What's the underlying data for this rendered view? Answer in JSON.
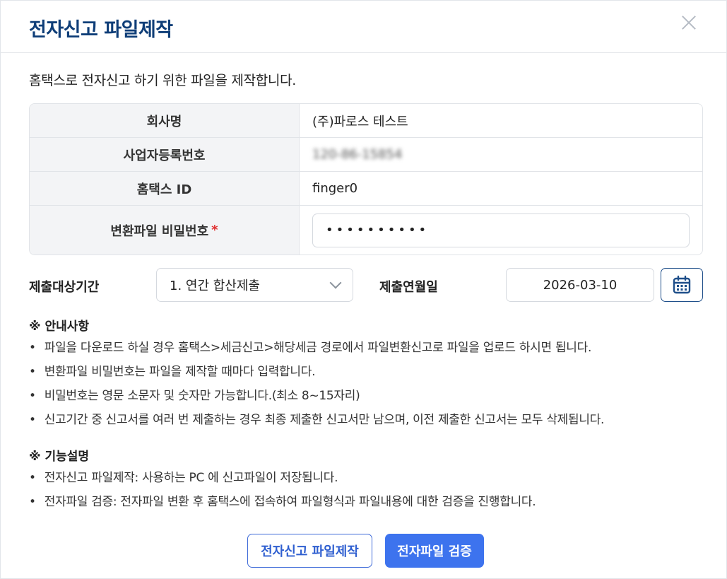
{
  "dialog": {
    "title": "전자신고 파일제작",
    "intro": "홈택스로 전자신고 하기 위한 파일을 제작합니다."
  },
  "info": {
    "company_label": "회사명",
    "company_value": "(주)파로스 테스트",
    "bizno_label": "사업자등록번호",
    "bizno_value": "120-86-15854",
    "hometax_label": "홈택스 ID",
    "hometax_value": "finger0",
    "password_label": "변환파일 비밀번호",
    "password_required": "*",
    "password_value": "••••••••••"
  },
  "form": {
    "period_label": "제출대상기간",
    "period_selected": "1. 연간 합산제출",
    "submit_date_label": "제출연월일",
    "submit_date_value": "2026-03-10"
  },
  "guide": {
    "title": "※ 안내사항",
    "items": [
      "파일을 다운로드 하실 경우 홈택스>세금신고>해당세금 경로에서 파일변환신고로 파일을 업로드 하시면 됩니다.",
      "변환파일 비밀번호는 파일을 제작할 때마다 입력합니다.",
      "비밀번호는 영문 소문자 및 숫자만 가능합니다.(최소 8~15자리)",
      "신고기간 중 신고서를 여러 번 제출하는 경우 최종 제출한 신고서만 남으며, 이전 제출한 신고서는 모두 삭제됩니다."
    ]
  },
  "features": {
    "title": "※ 기능설명",
    "items": [
      "전자신고 파일제작: 사용하는 PC 에 신고파일이 저장됩니다.",
      "전자파일 검증: 전자파일 변환 후 홈택스에 접속하여 파일형식과 파일내용에 대한 검증을 진행합니다."
    ]
  },
  "buttons": {
    "create_label": "전자신고 파일제작",
    "verify_label": "전자파일 검증"
  },
  "icons": {
    "close": "close-icon",
    "calendar": "calendar-icon",
    "dropdown": "chevron-down-icon"
  },
  "colors": {
    "title": "#0f3e78",
    "primary": "#3d73ee",
    "required": "#e03131"
  }
}
